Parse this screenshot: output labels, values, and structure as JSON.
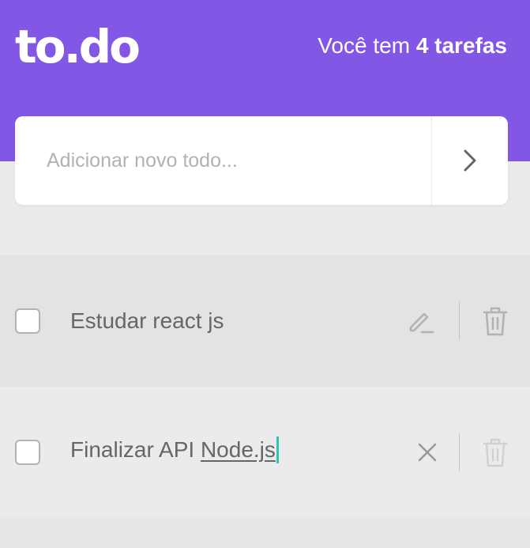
{
  "header": {
    "logo": "to.do",
    "count_prefix": "Você tem ",
    "count_value": "4 tarefas"
  },
  "new_todo": {
    "placeholder": "Adicionar novo todo...",
    "submit_icon": "chevron-right-icon"
  },
  "tasks": [
    {
      "title": "Estudar react js",
      "done": false,
      "editing": false,
      "action_icon": "pencil-icon",
      "delete_icon": "trash-icon"
    },
    {
      "title_plain": "Finalizar API ",
      "title_underlined": "Node.js",
      "done": false,
      "editing": true,
      "action_icon": "close-icon",
      "delete_icon": "trash-icon"
    }
  ],
  "colors": {
    "brand": "#8257e5",
    "background": "#ebebeb",
    "text": "#666666",
    "caret": "#2ec4b6"
  }
}
